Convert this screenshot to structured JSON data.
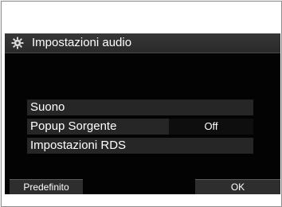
{
  "title": "Impostazioni audio",
  "title_icon": "gear-icon",
  "menu": {
    "items": [
      {
        "label": "Suono",
        "value": ""
      },
      {
        "label": "Popup Sorgente",
        "value": "Off"
      },
      {
        "label": "Impostazioni RDS",
        "value": ""
      }
    ]
  },
  "buttons": {
    "default_label": "Predefinito",
    "ok_label": "OK"
  },
  "colors": {
    "screen_background": "#030303",
    "title_bar": "#333333",
    "row_background": "#262626",
    "text": "#ffffff"
  }
}
